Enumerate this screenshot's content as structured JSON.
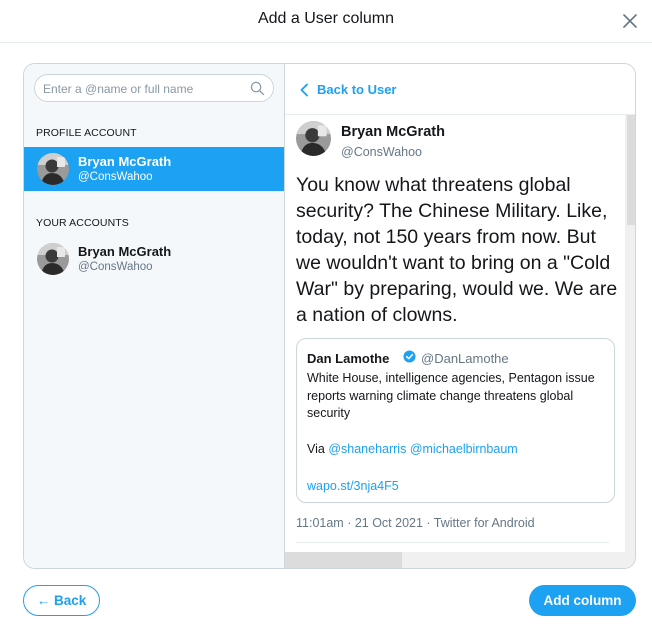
{
  "modal": {
    "title": "Add a User column"
  },
  "search": {
    "placeholder": "Enter a @name or full name",
    "value": ""
  },
  "sidebar": {
    "profile_account_label": "PROFILE ACCOUNT",
    "your_accounts_label": "YOUR ACCOUNTS",
    "profile_account": {
      "name": "Bryan McGrath",
      "handle": "@ConsWahoo"
    },
    "your_accounts": [
      {
        "name": "Bryan McGrath",
        "handle": "@ConsWahoo"
      }
    ]
  },
  "detail": {
    "back_label": "Back to User",
    "tweet": {
      "author_name": "Bryan McGrath",
      "author_handle": "@ConsWahoo",
      "text": "You know what threatens global security? The Chinese Military. Like, today, not 150 years from now. But we wouldn't want to bring on a \"Cold War\" by preparing, would we. We are a nation of clowns.",
      "meta": "11:01am · 21 Oct 2021 · Twitter for Android",
      "quote": {
        "author_name": "Dan Lamothe",
        "author_handle": "@DanLamothe",
        "text": "White House, intelligence agencies, Pentagon issue reports warning climate change threatens global security",
        "via_label": "Via",
        "via_mentions": [
          "@shaneharris",
          "@michaelbirnbaum"
        ],
        "url": "wapo.st/3nja4F5"
      }
    }
  },
  "footer": {
    "back_button": "← Back",
    "add_button": "Add column"
  },
  "colors": {
    "accent": "#1da1f2",
    "text_primary": "#14171a",
    "text_secondary": "#657786",
    "border": "#ccd6dd",
    "sidebar_bg": "#f5f8fa"
  },
  "icons": {
    "close": "close-icon",
    "search": "search-icon",
    "back": "chevron-left-icon",
    "verified": "verified-badge-icon"
  }
}
